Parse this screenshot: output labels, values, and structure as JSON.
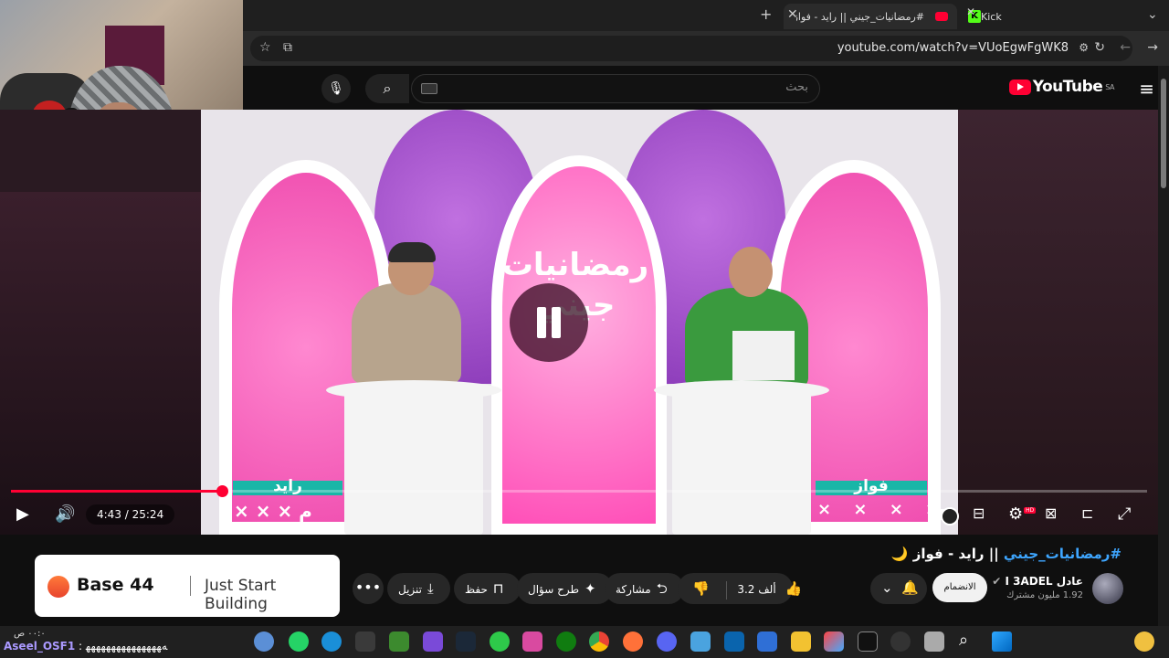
{
  "browser": {
    "tabs": [
      {
        "label": "#رمضانيات_جيني || رايد - فواز",
        "active": true
      },
      {
        "label": "Kick",
        "active": false
      }
    ],
    "url": "youtube.com/watch?v=VUoEgwFgWK8"
  },
  "youtube": {
    "logo_text": "YouTube",
    "region": "SA",
    "search_placeholder": "بحث"
  },
  "video": {
    "overlay_title_line1": "رمضانيات",
    "overlay_title_line2": "جيني",
    "left_player": "رايد",
    "right_player": "فواز",
    "left_marks": "× × × م",
    "right_marks": "× × × × ×",
    "current_time": "4:43",
    "duration": "25:24",
    "time_display": "4:43 / 25:24",
    "progress_fraction": 0.186
  },
  "below": {
    "title_tag": "#رمضانيات_جيني",
    "title_rest": " || رايد - فواز 🌙",
    "channel_name": "عادل I 3ADEL",
    "subscribers": "1.92 مليون مشترك",
    "subscribe_label": "الانضمام",
    "likes": "3.2 ألف",
    "share_label": "مشاركة",
    "ask_label": "طرح سؤال",
    "save_label": "حفظ",
    "download_label": "تنزيل"
  },
  "ad": {
    "brand": "Base 44",
    "slogan": "Just Start Building"
  },
  "overlay_chat": {
    "user": "Aseel_OSF1",
    "message": ": ﻪﻬﻬﻬﻬﻬﻬﻬﻬﻬﻬﻬﻬﻬﻬﻬ"
  },
  "colors": {
    "youtube_red": "#ff0033",
    "link_blue": "#3ea6ff",
    "kick_green": "#53fc18",
    "score_teal": "#19b6a7"
  }
}
